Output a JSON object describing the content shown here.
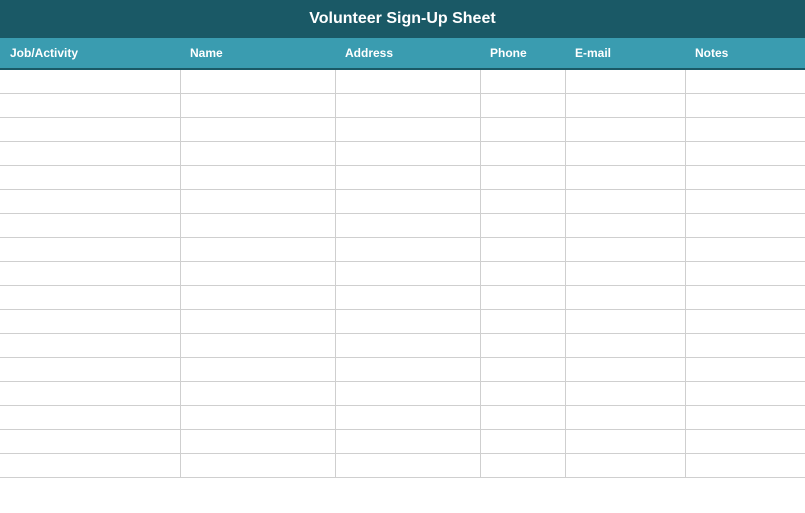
{
  "title": "Volunteer Sign-Up Sheet",
  "columns": {
    "activity": "Job/Activity",
    "name": "Name",
    "address": "Address",
    "phone": "Phone",
    "email": "E-mail",
    "notes": "Notes"
  },
  "rows": [
    {
      "activity": "",
      "name": "",
      "address": "",
      "phone": "",
      "email": "",
      "notes": ""
    },
    {
      "activity": "",
      "name": "",
      "address": "",
      "phone": "",
      "email": "",
      "notes": ""
    },
    {
      "activity": "",
      "name": "",
      "address": "",
      "phone": "",
      "email": "",
      "notes": ""
    },
    {
      "activity": "",
      "name": "",
      "address": "",
      "phone": "",
      "email": "",
      "notes": ""
    },
    {
      "activity": "",
      "name": "",
      "address": "",
      "phone": "",
      "email": "",
      "notes": ""
    },
    {
      "activity": "",
      "name": "",
      "address": "",
      "phone": "",
      "email": "",
      "notes": ""
    },
    {
      "activity": "",
      "name": "",
      "address": "",
      "phone": "",
      "email": "",
      "notes": ""
    },
    {
      "activity": "",
      "name": "",
      "address": "",
      "phone": "",
      "email": "",
      "notes": ""
    },
    {
      "activity": "",
      "name": "",
      "address": "",
      "phone": "",
      "email": "",
      "notes": ""
    },
    {
      "activity": "",
      "name": "",
      "address": "",
      "phone": "",
      "email": "",
      "notes": ""
    },
    {
      "activity": "",
      "name": "",
      "address": "",
      "phone": "",
      "email": "",
      "notes": ""
    },
    {
      "activity": "",
      "name": "",
      "address": "",
      "phone": "",
      "email": "",
      "notes": ""
    },
    {
      "activity": "",
      "name": "",
      "address": "",
      "phone": "",
      "email": "",
      "notes": ""
    },
    {
      "activity": "",
      "name": "",
      "address": "",
      "phone": "",
      "email": "",
      "notes": ""
    },
    {
      "activity": "",
      "name": "",
      "address": "",
      "phone": "",
      "email": "",
      "notes": ""
    },
    {
      "activity": "",
      "name": "",
      "address": "",
      "phone": "",
      "email": "",
      "notes": ""
    },
    {
      "activity": "",
      "name": "",
      "address": "",
      "phone": "",
      "email": "",
      "notes": ""
    }
  ]
}
